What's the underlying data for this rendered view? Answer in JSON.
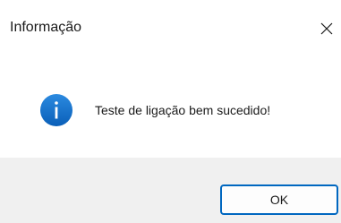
{
  "dialog": {
    "title": "Informação",
    "close_icon": "close-icon",
    "info_icon": "info-icon",
    "message": "Teste de ligação bem sucedido!",
    "ok_label": "OK",
    "accent_color": "#0067c0",
    "footer_color": "#f0f0f0"
  }
}
